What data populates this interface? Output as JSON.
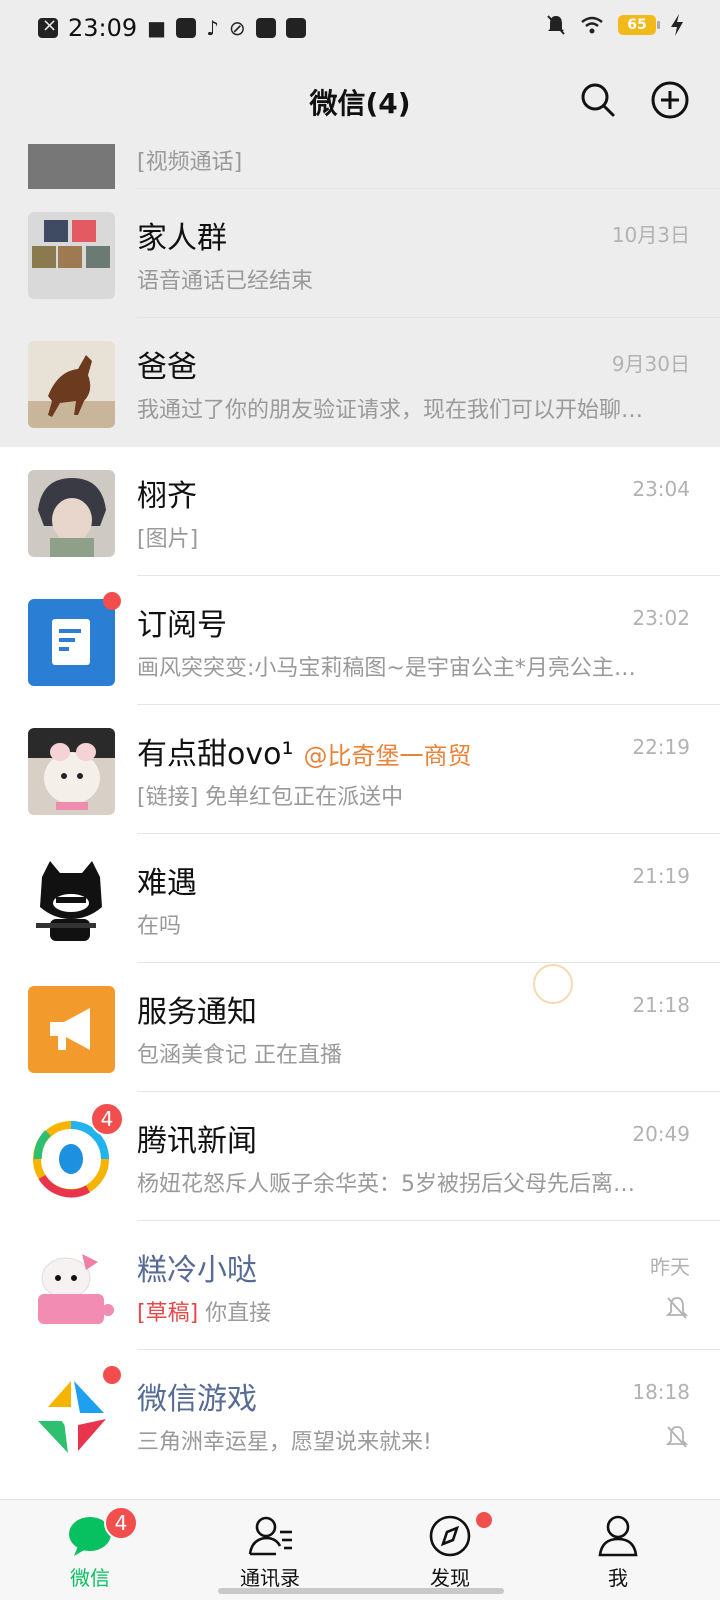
{
  "status_bar": {
    "time": "23:09",
    "battery": "65"
  },
  "header": {
    "title": "微信(4)"
  },
  "chats": [
    {
      "preview": "[视频通话]"
    },
    {
      "name": "家人群",
      "preview": "语音通话已经结束",
      "time": "10月3日"
    },
    {
      "name": "爸爸",
      "preview": "我通过了你的朋友验证请求，现在我们可以开始聊…",
      "time": "9月30日"
    },
    {
      "name": "栩齐",
      "preview": "[图片]",
      "time": "23:04"
    },
    {
      "name": "订阅号",
      "preview": "画风突突变:小马宝莉稿图~是宇宙公主*月亮公主…",
      "time": "23:02"
    },
    {
      "name": "有点甜ovo¹",
      "mention": "@比奇堡一商贸",
      "preview": "[链接] 免单红包正在派送中",
      "time": "22:19"
    },
    {
      "name": "难遇",
      "preview": "在吗",
      "time": "21:19"
    },
    {
      "name": "服务通知",
      "preview": "包涵美食记 正在直播",
      "time": "21:18"
    },
    {
      "name": "腾讯新闻",
      "preview": "杨妞花怒斥人贩子余华英：5岁被拐后父母先后离…",
      "time": "20:49",
      "badge": "4"
    },
    {
      "name": "糕冷小哒",
      "draft_tag": "[草稿]",
      "preview": "你直接",
      "time": "昨天"
    },
    {
      "name": "微信游戏",
      "preview": "三角洲幸运星，愿望说来就来!",
      "time": "18:18"
    }
  ],
  "tabs": [
    {
      "label": "微信",
      "badge": "4"
    },
    {
      "label": "通讯录"
    },
    {
      "label": "发现"
    },
    {
      "label": "我"
    }
  ],
  "colors": {
    "accent": "#07c160",
    "badge": "#f24e4e",
    "pinned_bg": "#ededed",
    "link_name": "#576b95",
    "mention": "#e8833a"
  }
}
